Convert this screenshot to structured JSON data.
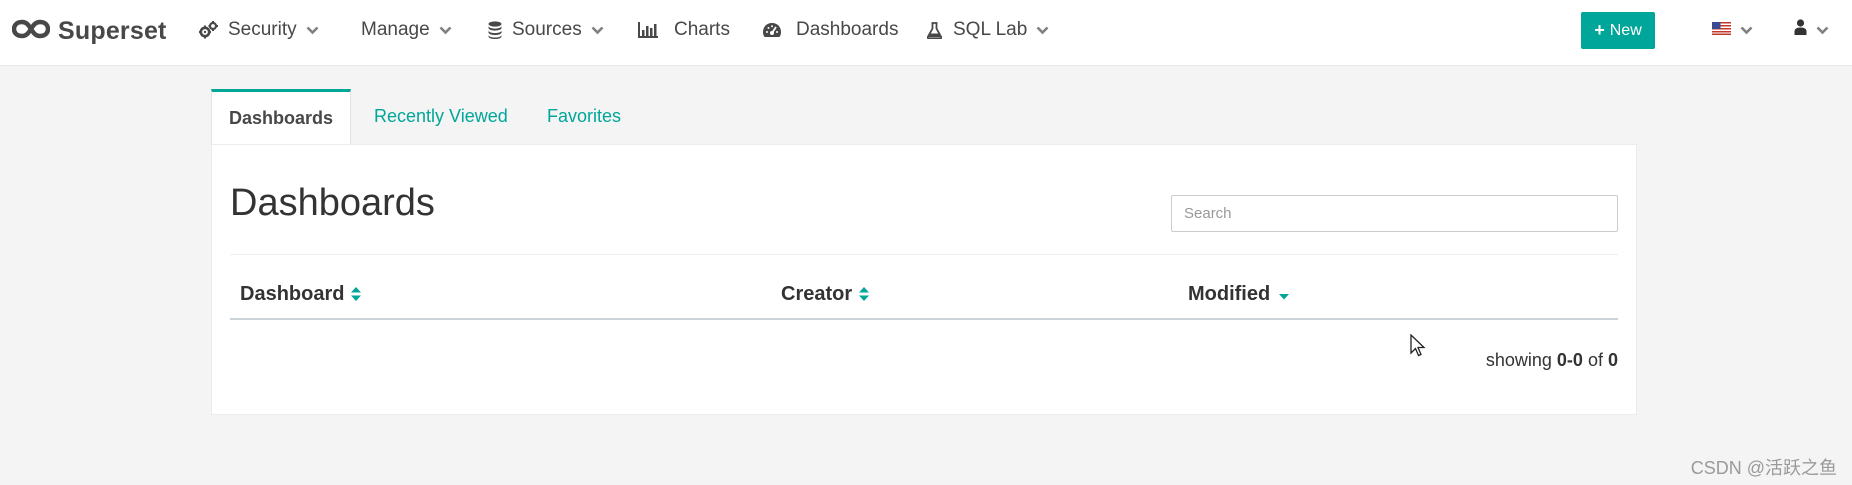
{
  "brand": {
    "name": "Superset"
  },
  "nav": {
    "security": "Security",
    "manage": "Manage",
    "sources": "Sources",
    "charts": "Charts",
    "dashboards": "Dashboards",
    "sql_lab": "SQL Lab"
  },
  "actions": {
    "new_label": "New"
  },
  "tabs": [
    "Dashboards",
    "Recently Viewed",
    "Favorites"
  ],
  "page": {
    "title": "Dashboards",
    "search_placeholder": "Search"
  },
  "table": {
    "columns": [
      "Dashboard",
      "Creator",
      "Modified"
    ],
    "rows": []
  },
  "pagination": {
    "prefix": "showing",
    "range": "0-0",
    "of_word": "of",
    "total": "0"
  },
  "watermark": "CSDN @活跃之鱼",
  "colors": {
    "accent": "#00a699",
    "text": "#484848",
    "background": "#f4f4f4"
  },
  "icons": {
    "brand": "infinity-logo-icon",
    "security": "gears-icon",
    "sources": "database-icon",
    "charts": "bar-chart-icon",
    "dashboards": "dashboard-gauge-icon",
    "sql_lab": "flask-icon",
    "language": "us-flag-icon",
    "user": "user-icon"
  }
}
